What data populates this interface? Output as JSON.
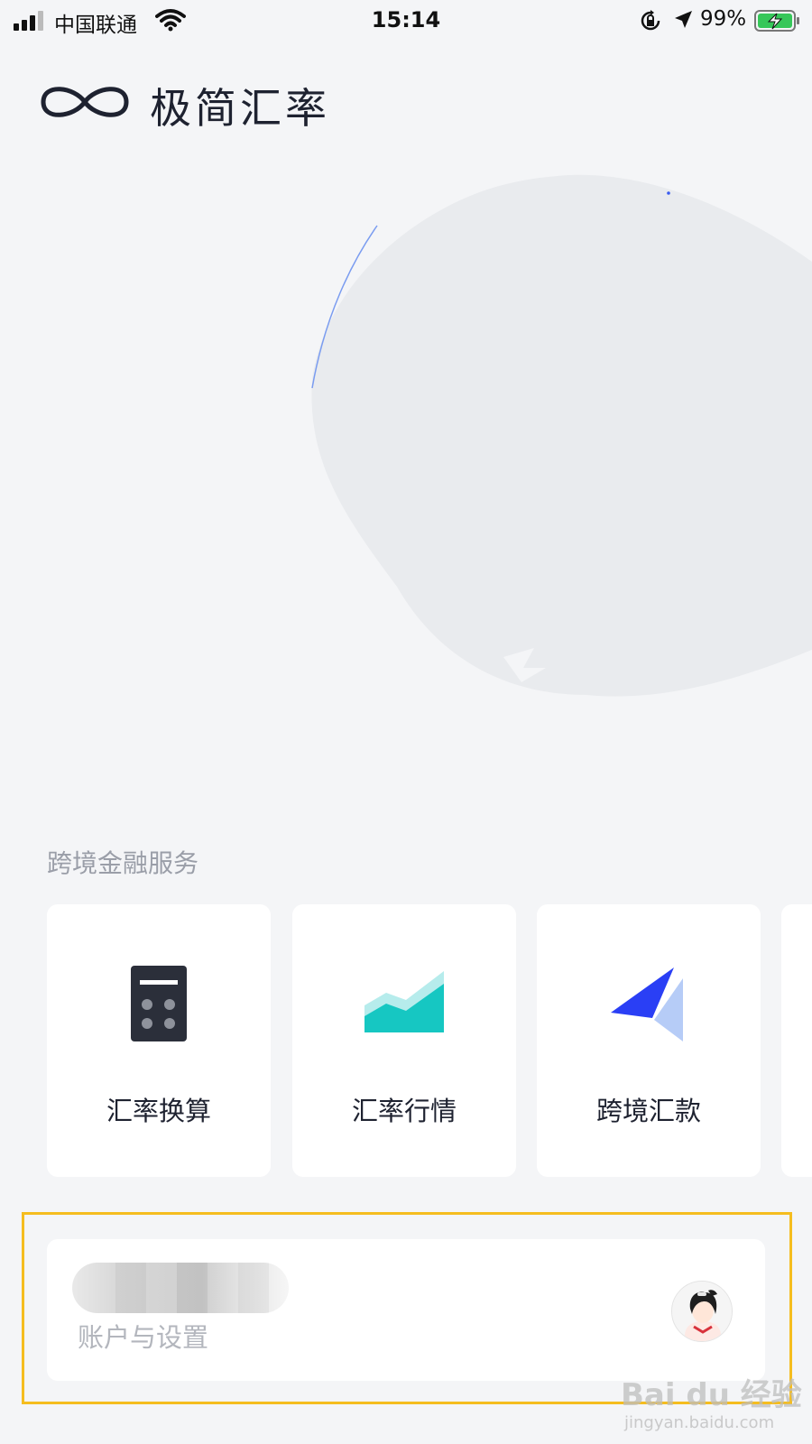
{
  "status_bar": {
    "carrier": "中国联通",
    "time": "15:14",
    "battery_percent": "99%",
    "icons": [
      "signal-icon",
      "wifi-icon",
      "orientation-lock-icon",
      "location-icon",
      "battery-charging-icon"
    ]
  },
  "header": {
    "app_title": "极简汇率",
    "logo_icon": "infinity-logo-icon"
  },
  "services": {
    "section_title": "跨境金融服务",
    "items": [
      {
        "label": "汇率换算",
        "icon": "calculator-icon",
        "color": "#2b2f3a"
      },
      {
        "label": "汇率行情",
        "icon": "area-chart-icon",
        "color": "#16c7c2"
      },
      {
        "label": "跨境汇款",
        "icon": "paper-plane-icon",
        "color": "#2a3ff5"
      }
    ]
  },
  "account": {
    "label": "账户与设置",
    "avatar_icon": "user-avatar-icon"
  },
  "watermark": {
    "main": "Bai du 经验",
    "sub": "jingyan.baidu.com"
  },
  "colors": {
    "background": "#f4f5f7",
    "highlight": "#f5bd1f",
    "globe": "#e9ebee"
  }
}
